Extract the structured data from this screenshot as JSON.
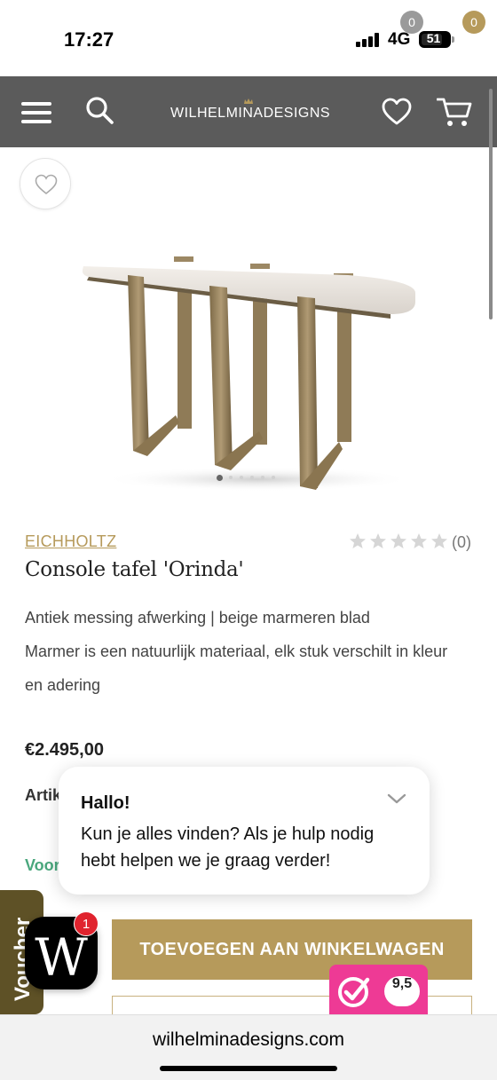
{
  "status_bar": {
    "time": "17:27",
    "network": "4G",
    "battery": "51"
  },
  "header": {
    "logo_text": "WILHELMINADESIGNS",
    "wishlist_count": "0",
    "cart_count": "0",
    "icons": [
      "menu-icon",
      "search-icon",
      "heart-icon",
      "cart-icon"
    ],
    "background_color": "#5b5b5b",
    "accent_color": "#b69a5b"
  },
  "gallery": {
    "image_count": 6,
    "active_index": 0
  },
  "product": {
    "brand": "EICHHOLTZ",
    "rating_stars": 0,
    "review_count": "(0)",
    "title": "Console tafel 'Orinda'",
    "description": [
      "Antiek messing afwerking | beige marmeren blad",
      "Marmer is een natuurlijk materiaal, elk stuk verschilt in kleur",
      "en adering"
    ],
    "price": "€2.495,00",
    "artikel_partial": "Artik",
    "voor_partial": "Voor"
  },
  "chat": {
    "title": "Hallo!",
    "message_lines": [
      "Kun je alles vinden? Als je hulp nodig",
      "hebt helpen we je graag verder!"
    ]
  },
  "voucher_tab": "Voucher",
  "launcher": {
    "letter": "W",
    "badge": "1"
  },
  "actions": {
    "add_to_cart": "TOEVOEGEN AAN WINKELWAGEN"
  },
  "kiyoh": {
    "score": "9,5",
    "color": "#ee3a95"
  },
  "browser": {
    "url": "wilhelminadesigns.com"
  }
}
